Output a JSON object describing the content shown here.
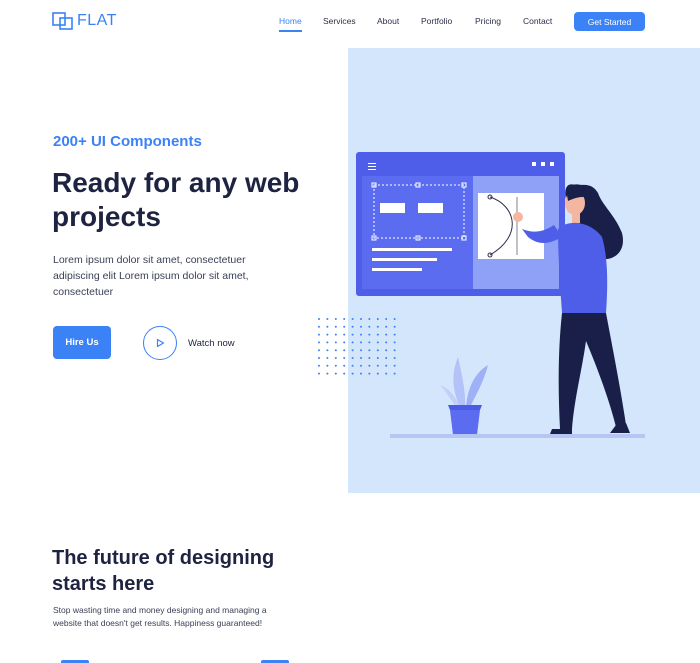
{
  "brand": {
    "name": "FLAT",
    "logo_icon": "overlapping-squares-icon",
    "accent": "#3b82f6"
  },
  "nav": {
    "items": [
      {
        "label": "Home",
        "active": true
      },
      {
        "label": "Services",
        "active": false
      },
      {
        "label": "About",
        "active": false
      },
      {
        "label": "Portfolio",
        "active": false
      },
      {
        "label": "Pricing",
        "active": false
      },
      {
        "label": "Contact",
        "active": false
      }
    ],
    "cta_label": "Get Started"
  },
  "hero": {
    "eyebrow": "200+ UI Components",
    "title": "Ready for any web projects",
    "description": "Lorem ipsum dolor sit amet, consectetuer adipiscing elit Lorem ipsum dolor sit amet, consectetuer",
    "primary_button": "Hire Us",
    "secondary_button": "Watch now",
    "secondary_icon": "play-icon",
    "illustration_bg": "#d4e6fb"
  },
  "section": {
    "title": "The future of designing starts here",
    "description": "Stop wasting time and money designing and managing a website that doesn't get results. Happiness guaranteed!"
  }
}
